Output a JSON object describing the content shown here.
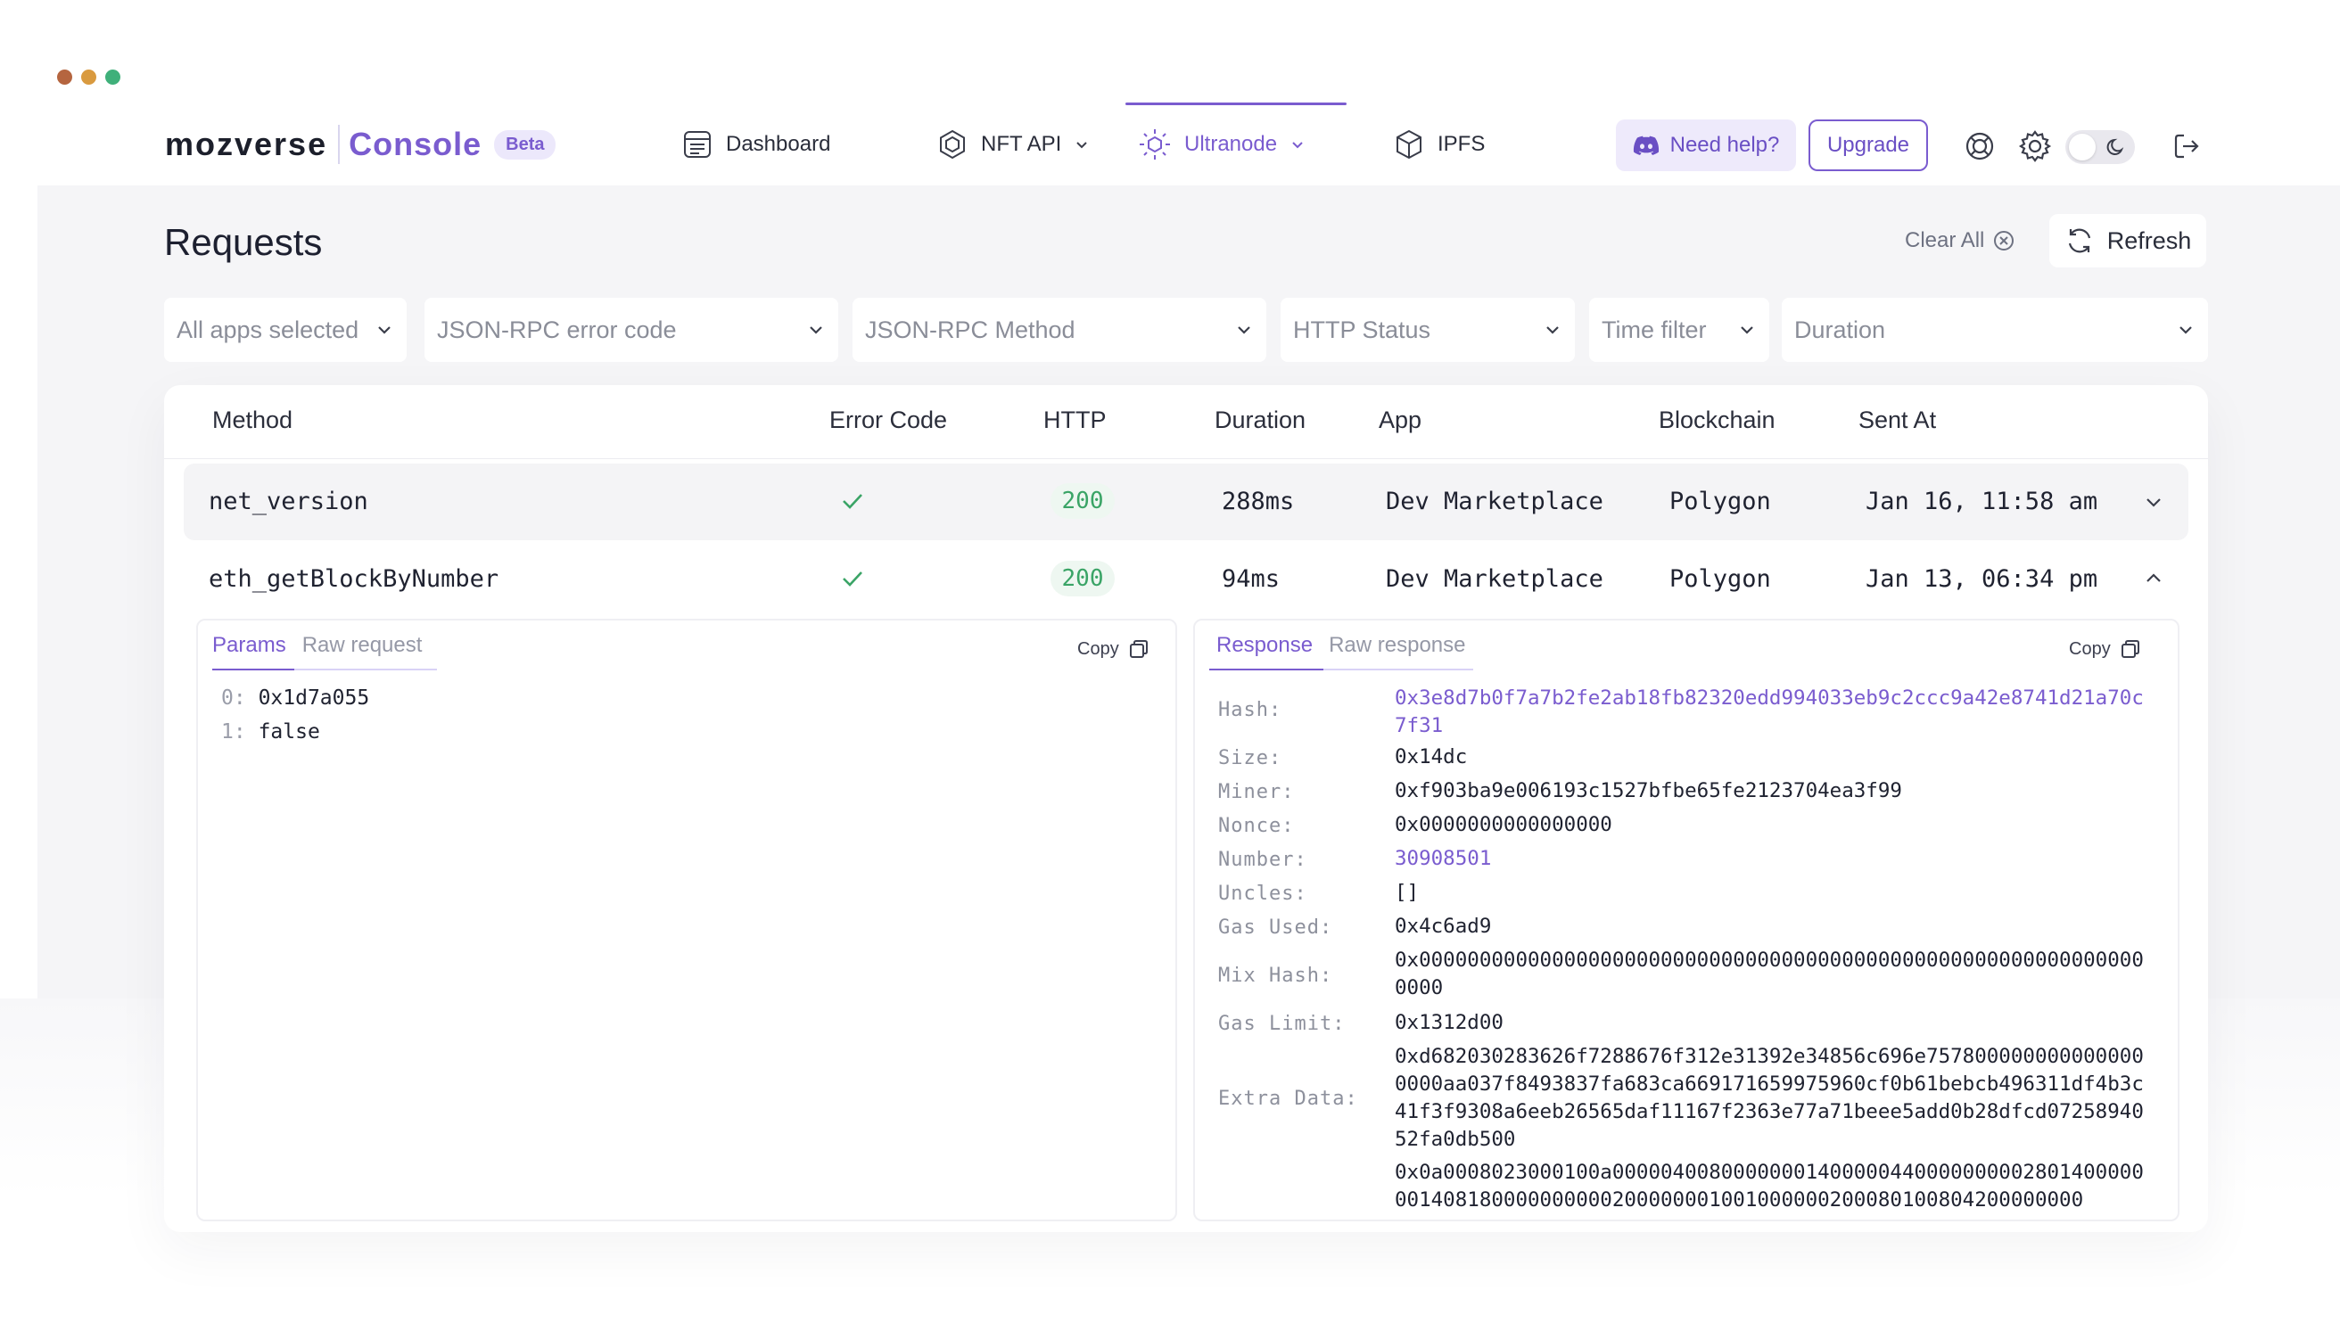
{
  "window_dots": [
    "#b5653f",
    "#d99a3f",
    "#3fb07a"
  ],
  "brand": {
    "name": "mozverse",
    "product": "Console",
    "badge": "Beta"
  },
  "nav": [
    {
      "label": "Dashboard",
      "icon": "dashboard-icon",
      "active": false
    },
    {
      "label": "NFT API",
      "icon": "nft-api-icon",
      "active": false,
      "has_dropdown": true
    },
    {
      "label": "Ultranode",
      "icon": "ultranode-icon",
      "active": true,
      "has_dropdown": true
    },
    {
      "label": "IPFS",
      "icon": "ipfs-cube-icon",
      "active": false
    }
  ],
  "header_actions": {
    "help_label": "Need help?",
    "upgrade_label": "Upgrade",
    "icons": [
      "support-lifebuoy-icon",
      "settings-gear-icon",
      "theme-toggle",
      "logout-icon"
    ]
  },
  "page": {
    "title": "Requests",
    "clear_all_label": "Clear All",
    "refresh_label": "Refresh"
  },
  "filters": [
    {
      "label": "All apps selected"
    },
    {
      "label": "JSON-RPC error code"
    },
    {
      "label": "JSON-RPC Method"
    },
    {
      "label": "HTTP Status"
    },
    {
      "label": "Time filter"
    },
    {
      "label": "Duration"
    }
  ],
  "table": {
    "columns": [
      "Method",
      "Error Code",
      "HTTP",
      "Duration",
      "App",
      "Blockchain",
      "Sent At"
    ],
    "rows": [
      {
        "method": "net_version",
        "error_ok": true,
        "http": "200",
        "duration": "288ms",
        "app": "Dev Marketplace",
        "blockchain": "Polygon",
        "sent_at": "Jan 16, 11:58 am",
        "expanded": false
      },
      {
        "method": "eth_getBlockByNumber",
        "error_ok": true,
        "http": "200",
        "duration": "94ms",
        "app": "Dev Marketplace",
        "blockchain": "Polygon",
        "sent_at": "Jan 13, 06:34 pm",
        "expanded": true
      }
    ]
  },
  "params_panel": {
    "tabs": [
      "Params",
      "Raw request"
    ],
    "active_tab": "Params",
    "copy_label": "Copy",
    "params": [
      {
        "index": "0:",
        "value": "0x1d7a055"
      },
      {
        "index": "1:",
        "value": "false"
      }
    ]
  },
  "response_panel": {
    "tabs": [
      "Response",
      "Raw response"
    ],
    "active_tab": "Response",
    "copy_label": "Copy",
    "fields": [
      {
        "key": "Hash:",
        "value": "0x3e8d7b0f7a7b2fe2ab18fb82320edd994033eb9c2ccc9a42e8741d21a70c7f31",
        "link": true
      },
      {
        "key": "Size:",
        "value": "0x14dc",
        "link": false
      },
      {
        "key": "Miner:",
        "value": "0xf903ba9e006193c1527bfbe65fe2123704ea3f99",
        "link": false
      },
      {
        "key": "Nonce:",
        "value": "0x0000000000000000",
        "link": false
      },
      {
        "key": "Number:",
        "value": "30908501",
        "link": true
      },
      {
        "key": "Uncles:",
        "value": "[]",
        "link": false
      },
      {
        "key": "Gas Used:",
        "value": "0x4c6ad9",
        "link": false
      },
      {
        "key": "Mix Hash:",
        "value": "0x0000000000000000000000000000000000000000000000000000000000000000",
        "link": false
      },
      {
        "key": "Gas Limit:",
        "value": "0x1312d00",
        "link": false
      },
      {
        "key": "Extra Data:",
        "value": "0xd682030283626f7288676f312e31392e34856c696e7578000000000000000000aa037f8493837fa683ca669171659975960cf0b61bebcb496311df4b3c41f3f9308a6eeb26565daf11167f2363e77a71beee5add0b28dfcd0725894052fa0db500",
        "link": false
      },
      {
        "key": "",
        "value": "0x0a0008023000100a00000400800000001400000440000000002801400000001408180000000000200000001001000000200080100804200000000",
        "link": false
      }
    ]
  },
  "colors": {
    "accent": "#7a5ccf",
    "success": "#3aa466",
    "success_bg": "#eef7f1",
    "page_bg": "#f5f5f7"
  }
}
